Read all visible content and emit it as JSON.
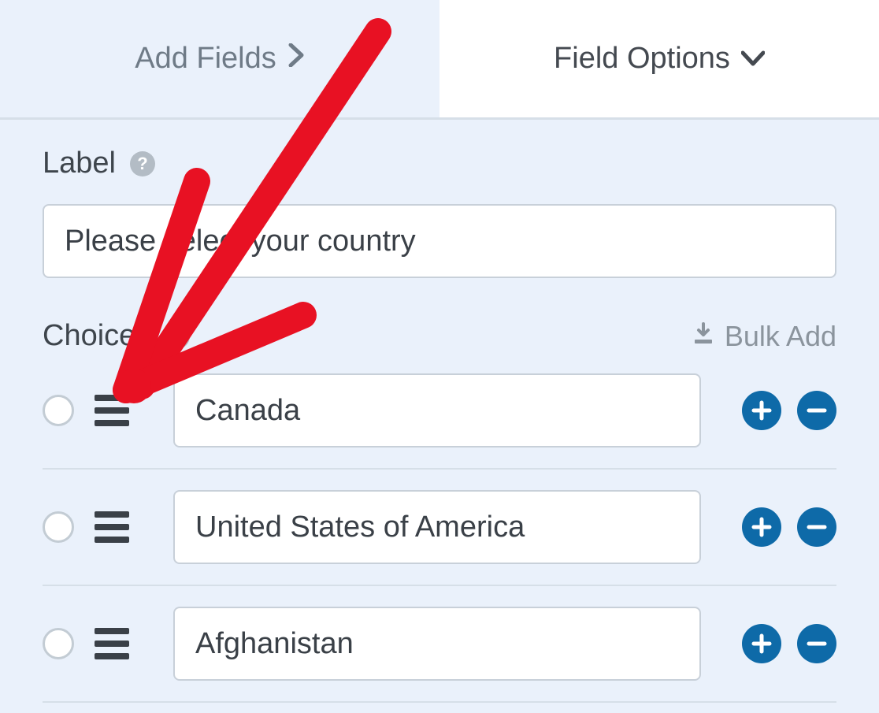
{
  "tabs": {
    "add_fields": "Add Fields",
    "field_options": "Field Options"
  },
  "label_section": {
    "title": "Label",
    "value": "Please select your country"
  },
  "choices_section": {
    "title": "Choices",
    "bulk_add": "Bulk Add",
    "items": [
      {
        "value": "Canada"
      },
      {
        "value": "United States of America"
      },
      {
        "value": "Afghanistan"
      }
    ]
  }
}
